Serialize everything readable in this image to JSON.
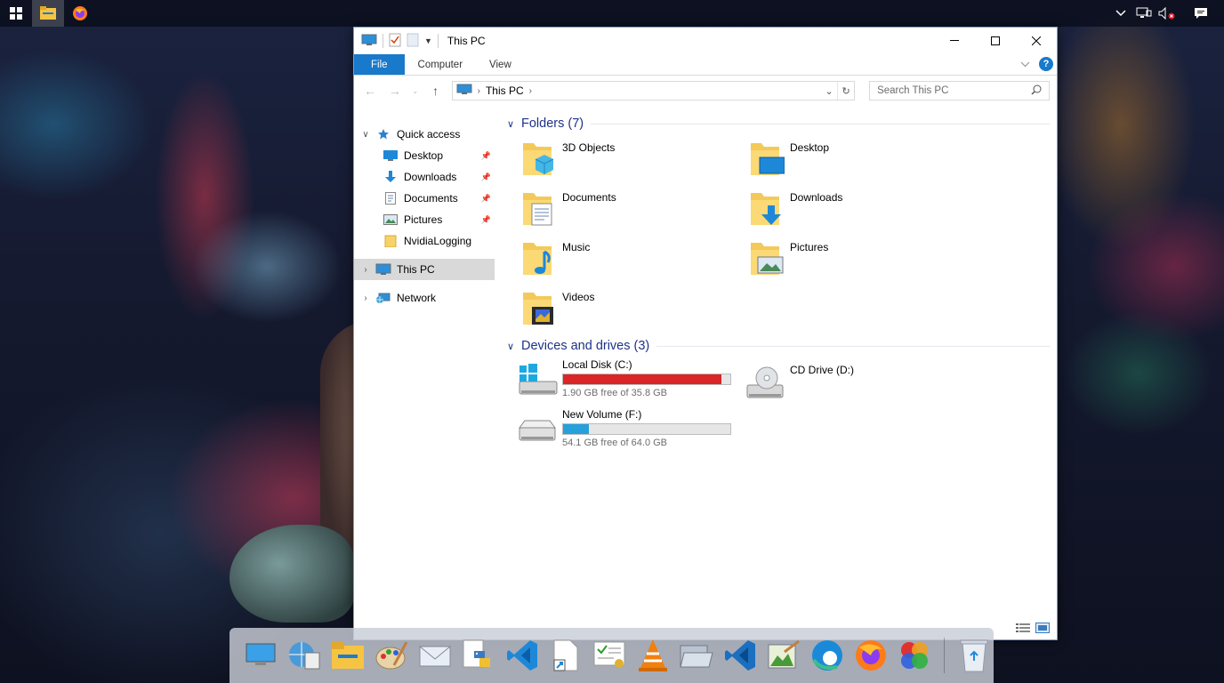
{
  "taskbar": {
    "items": [
      {
        "name": "start-icon"
      },
      {
        "name": "file-explorer-icon",
        "active": true
      },
      {
        "name": "firefox-icon"
      }
    ],
    "tray": [
      "chevron-up-icon",
      "network-icon",
      "volume-muted-icon",
      "notification-icon"
    ]
  },
  "window": {
    "title": "This PC",
    "ribbon_tabs": [
      "File",
      "Computer",
      "View"
    ],
    "address": {
      "crumbs": [
        "This PC"
      ],
      "search_placeholder": "Search This PC"
    }
  },
  "navpane": {
    "quick_access": "Quick access",
    "pinned": [
      {
        "label": "Desktop",
        "icon": "desktop-icon",
        "pinned": true
      },
      {
        "label": "Downloads",
        "icon": "downloads-icon",
        "pinned": true
      },
      {
        "label": "Documents",
        "icon": "documents-icon",
        "pinned": true
      },
      {
        "label": "Pictures",
        "icon": "pictures-icon",
        "pinned": true
      },
      {
        "label": "NvidiaLogging",
        "icon": "folder-icon",
        "pinned": false
      }
    ],
    "this_pc": "This PC",
    "network": "Network"
  },
  "content": {
    "folders_header": "Folders (7)",
    "folders": [
      {
        "label": "3D Objects",
        "icon": "3d-objects-icon"
      },
      {
        "label": "Desktop",
        "icon": "desktop-folder-icon"
      },
      {
        "label": "Documents",
        "icon": "documents-folder-icon"
      },
      {
        "label": "Downloads",
        "icon": "downloads-folder-icon"
      },
      {
        "label": "Music",
        "icon": "music-folder-icon"
      },
      {
        "label": "Pictures",
        "icon": "pictures-folder-icon"
      },
      {
        "label": "Videos",
        "icon": "videos-folder-icon"
      }
    ],
    "drives_header": "Devices and drives (3)",
    "drives": [
      {
        "label": "Local Disk (C:)",
        "free": "1.90 GB free of 35.8 GB",
        "used_fraction": 0.947,
        "bar_color": "#da2626",
        "has_bar": true,
        "icon": "windows-drive-icon"
      },
      {
        "label": "CD Drive (D:)",
        "has_bar": false,
        "icon": "cd-drive-icon"
      },
      {
        "label": "New Volume (F:)",
        "free": "54.1 GB free of 64.0 GB",
        "used_fraction": 0.155,
        "bar_color": "#26a0da",
        "has_bar": true,
        "icon": "drive-icon"
      }
    ]
  },
  "dock": {
    "items": [
      "remote-desktop-icon",
      "network-globe-icon",
      "file-explorer-icon",
      "paint-icon",
      "mail-icon",
      "python-icon",
      "vscode-icon",
      "shortcut-icon",
      "certificate-icon",
      "vlc-icon",
      "folder-open-icon",
      "vscode-insiders-icon",
      "image-editor-icon",
      "edge-icon",
      "firefox-icon",
      "photos-icon",
      "recycle-bin-icon"
    ]
  }
}
